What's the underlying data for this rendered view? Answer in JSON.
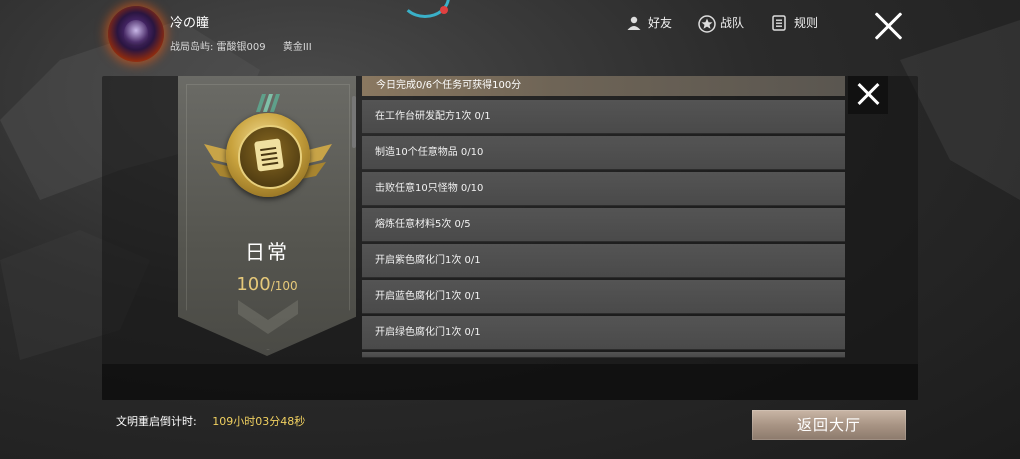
{
  "player": {
    "name": "冷の瞳",
    "island": "战局岛屿: 雷酸银009",
    "rank": "黄金III"
  },
  "nav": {
    "friends_label": "好友",
    "team_label": "战队",
    "rules_label": "规则"
  },
  "medal": {
    "title": "日常",
    "score": "100",
    "max_score": "/100"
  },
  "tasks": {
    "header": "今日完成0/6个任务可获得100分",
    "items": [
      "在工作台研发配方1次 0/1",
      "制造10个任意物品 0/10",
      "击败任意10只怪物 0/10",
      "熔炼任意材料5次 0/5",
      "开启紫色腐化门1次 0/1",
      "开启蓝色腐化门1次 0/1",
      "开启绿色腐化门1次 0/1"
    ]
  },
  "footer": {
    "countdown_label": "文明重启倒计时:",
    "countdown_value": "109小时03分48秒",
    "return_label": "返回大厅"
  },
  "colors": {
    "gold": "#e6c97a",
    "countdown": "#f0d060",
    "avatar_glow": "#e0571c"
  }
}
